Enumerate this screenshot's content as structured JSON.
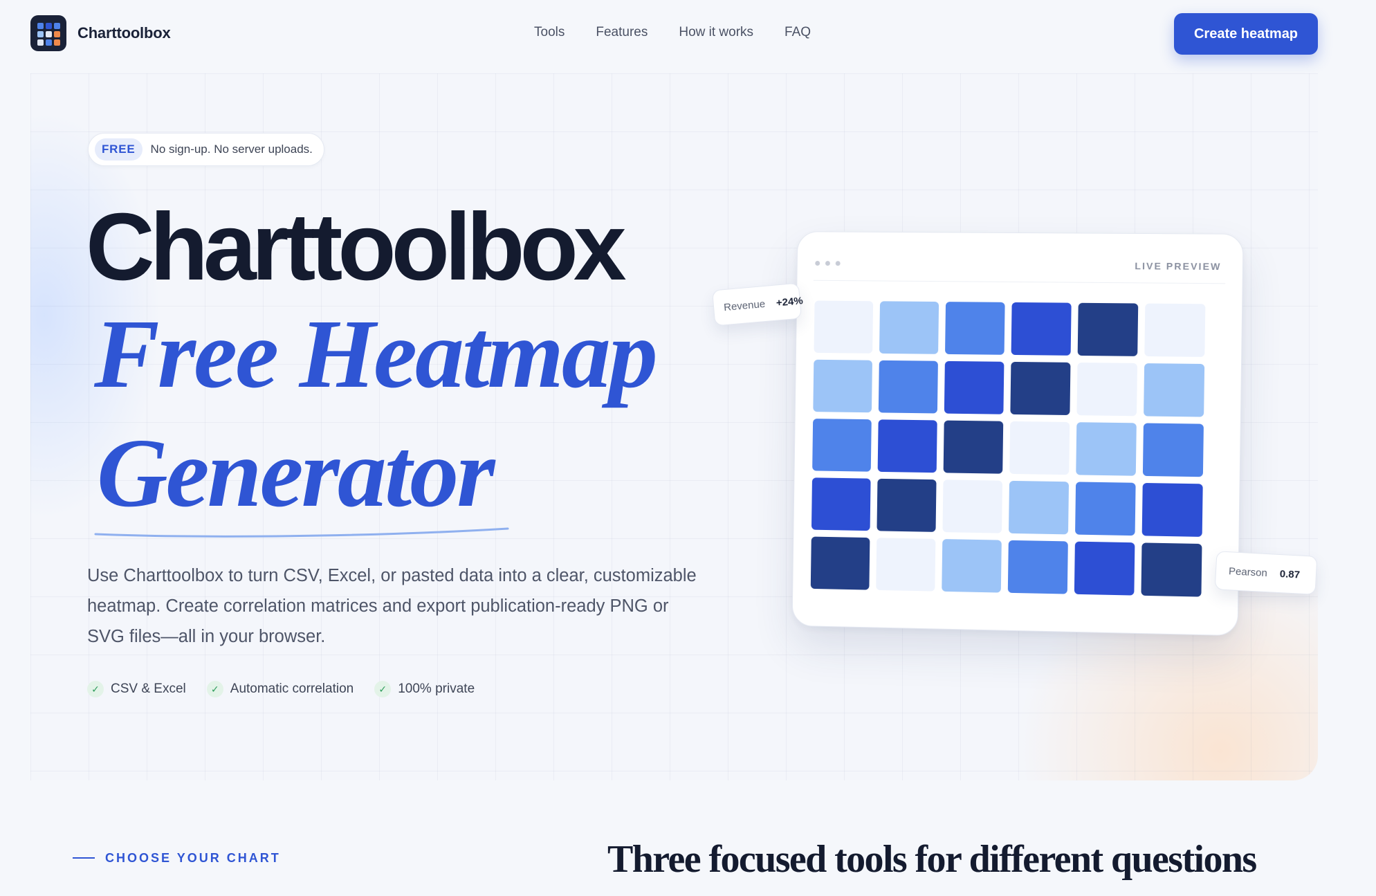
{
  "nav": {
    "brand": "Charttoolbox",
    "links": [
      "Tools",
      "Features",
      "How it works",
      "FAQ"
    ],
    "cta": "Create heatmap"
  },
  "hero": {
    "badge": "FREE",
    "badge_text": "No sign-up. No server uploads.",
    "title_line1": "Charttoolbox",
    "title_line2": "Free Heatmap",
    "title_line3": "Generator",
    "description": "Use Charttoolbox to turn CSV, Excel, or pasted data into a clear, customizable heatmap. Create correlation matrices and export publication-ready PNG or SVG files—all in your browser.",
    "features": [
      "CSV & Excel",
      "Automatic correlation",
      "100% private"
    ]
  },
  "preview": {
    "label": "LIVE PREVIEW",
    "revenue_label": "Revenue",
    "revenue_value": "+24%",
    "pearson_label": "Pearson",
    "pearson_value": "0.87",
    "palette": [
      "#eef3fd",
      "#9cc4f7",
      "#4f83ea",
      "#2d4fd4",
      "#233f87"
    ],
    "grid": [
      [
        0,
        1,
        2,
        3,
        4,
        0
      ],
      [
        1,
        2,
        3,
        4,
        0,
        1
      ],
      [
        2,
        3,
        4,
        0,
        1,
        2
      ],
      [
        3,
        4,
        0,
        1,
        2,
        3
      ],
      [
        4,
        0,
        1,
        2,
        3,
        4
      ]
    ]
  },
  "section": {
    "eyebrow": "CHOOSE YOUR CHART",
    "title": "Three focused tools for different questions"
  },
  "colors": {
    "accent": "#2f55d4",
    "ink": "#141b2f"
  },
  "icons": {
    "check": "✓"
  }
}
